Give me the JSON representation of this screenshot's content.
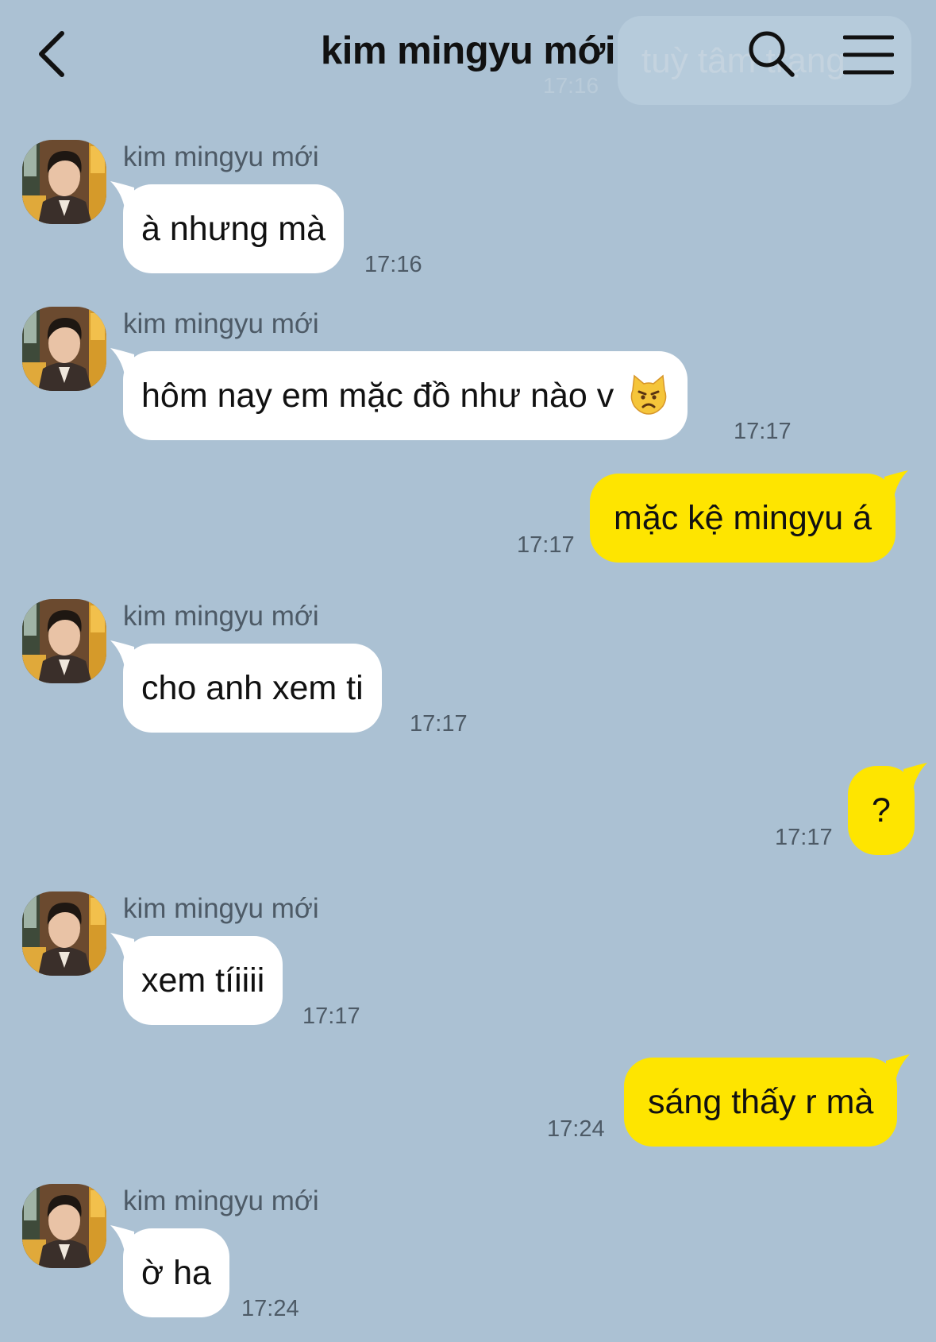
{
  "header": {
    "title": "kim mingyu mới",
    "back_icon": "chevron-left-icon",
    "search_icon": "search-icon",
    "menu_icon": "hamburger-menu-icon",
    "ghost_text": "tuỳ tâm trạng",
    "ghost_time": "17:16"
  },
  "messages": [
    {
      "side": "in",
      "sender": "kim mingyu mới",
      "text": "à nhưng mà",
      "time": "17:16"
    },
    {
      "side": "in",
      "sender": "kim mingyu mới",
      "text": "hôm nay em mặc đồ như nào v",
      "emoji": "pouting-cat-icon",
      "time": "17:17"
    },
    {
      "side": "out",
      "text": "mặc kệ mingyu á",
      "time": "17:17"
    },
    {
      "side": "in",
      "sender": "kim mingyu mới",
      "text": "cho anh xem ti",
      "time": "17:17"
    },
    {
      "side": "out",
      "text": "?",
      "time": "17:17"
    },
    {
      "side": "in",
      "sender": "kim mingyu mới",
      "text": "xem tíiiii",
      "time": "17:17"
    },
    {
      "side": "out",
      "text": "sáng thấy r mà",
      "time": "17:24"
    },
    {
      "side": "in",
      "sender": "kim mingyu mới",
      "text": "ờ ha",
      "time": "17:24"
    }
  ],
  "colors": {
    "background": "#abc1d3",
    "incoming_bubble": "#ffffff",
    "outgoing_bubble": "#fee500"
  }
}
